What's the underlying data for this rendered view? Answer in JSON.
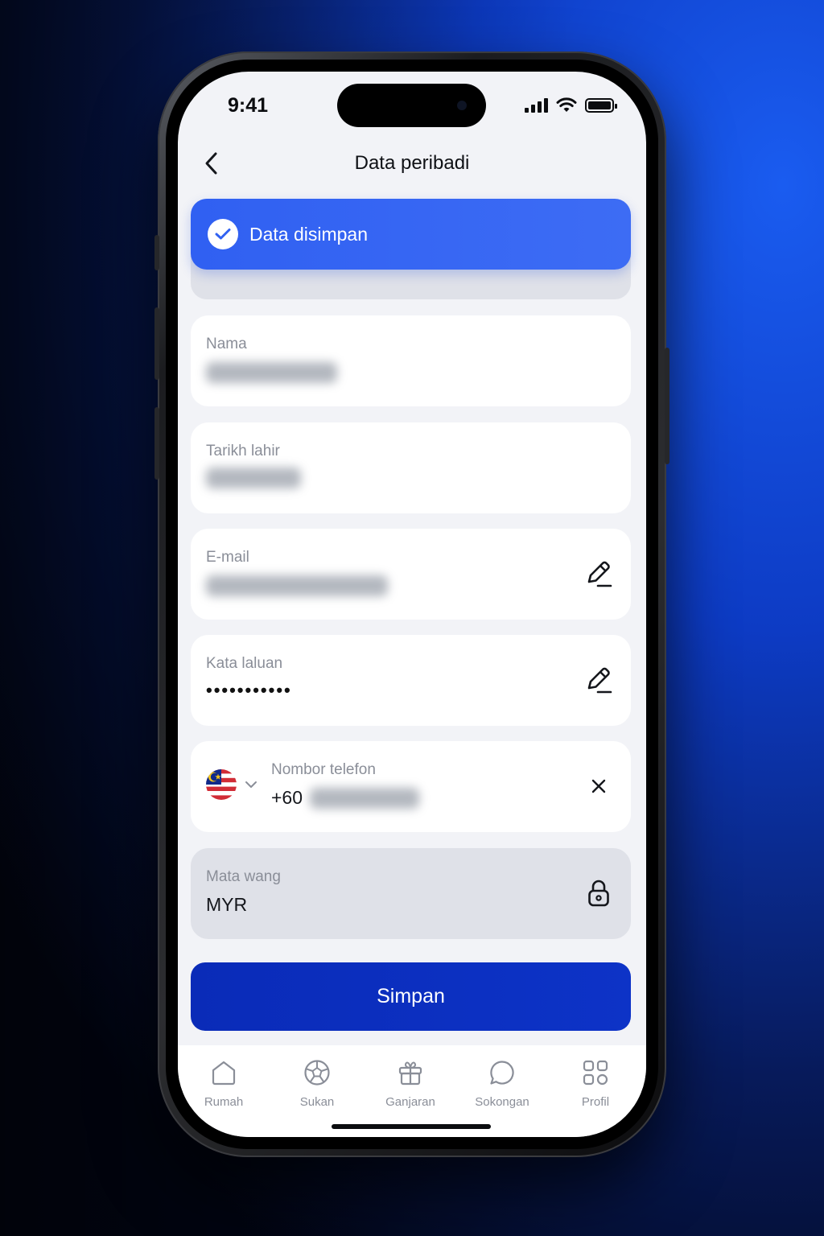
{
  "status_bar": {
    "time": "9:41"
  },
  "header": {
    "title": "Data peribadi"
  },
  "toast": {
    "message": "Data disimpan"
  },
  "fields": {
    "name": {
      "label": "Nama",
      "value": ""
    },
    "birthdate": {
      "label": "Tarikh lahir",
      "value": ""
    },
    "email": {
      "label": "E-mail",
      "value": "",
      "action_icon": "edit-pencil"
    },
    "password": {
      "label": "Kata laluan",
      "value": "•••••••••••",
      "action_icon": "edit-pencil"
    },
    "phone": {
      "label": "Nombor telefon",
      "country_code": "+60",
      "value": "",
      "flag": "malaysia",
      "action_icon": "clear-x"
    },
    "currency": {
      "label": "Mata wang",
      "value": "MYR",
      "action_icon": "lock"
    }
  },
  "save_button": {
    "label": "Simpan"
  },
  "tabs": [
    {
      "label": "Rumah",
      "icon": "home-icon"
    },
    {
      "label": "Sukan",
      "icon": "soccer-ball-icon"
    },
    {
      "label": "Ganjaran",
      "icon": "gift-icon"
    },
    {
      "label": "Sokongan",
      "icon": "chat-bubble-icon"
    },
    {
      "label": "Profil",
      "icon": "grid-icon"
    }
  ],
  "colors": {
    "accent": "#3162f2",
    "primary_button": "#0b2eba",
    "background": "#f2f3f7",
    "card": "#ffffff",
    "disabled_card": "#dfe1e8",
    "label": "#8a8e98"
  }
}
